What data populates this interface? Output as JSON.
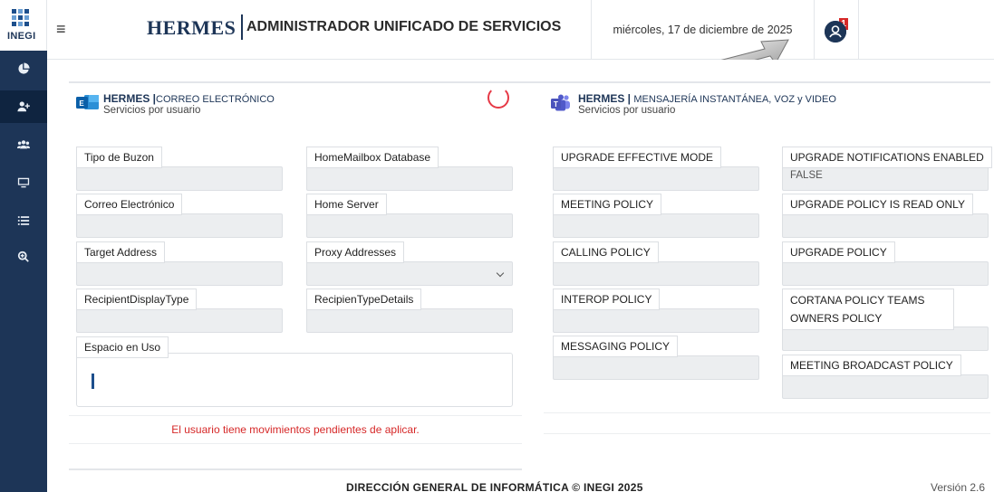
{
  "sidebar": {
    "logo_text": "INEGI",
    "items": [
      {
        "icon": "pie-chart-icon"
      },
      {
        "icon": "add-user-icon",
        "active": true
      },
      {
        "icon": "users-icon"
      },
      {
        "icon": "monitor-icon"
      },
      {
        "icon": "list-icon"
      },
      {
        "icon": "zoom-search-icon"
      }
    ]
  },
  "header": {
    "menu_icon": "hamburger-menu-icon",
    "brand": "HERMES",
    "subtitle": "ADMINISTRADOR UNIFICADO DE SERVICIOS",
    "date": "miércoles, 17 de diciembre de 2025",
    "notification_count": "1"
  },
  "left_panel": {
    "title_brand": "HERMES |",
    "title_rest": "CORREO ELECTRÓNICO",
    "subtitle": "Servicios por usuario",
    "fields": [
      {
        "label": "Tipo de Buzon",
        "value": ""
      },
      {
        "label": "HomeMailbox Database",
        "value": ""
      },
      {
        "label": "Correo Electrónico",
        "value": ""
      },
      {
        "label": "Home Server",
        "value": ""
      },
      {
        "label": "Target Address",
        "value": ""
      },
      {
        "label": "Proxy Addresses",
        "value": ""
      },
      {
        "label": "RecipientDisplayType",
        "value": ""
      },
      {
        "label": "RecipienTypeDetails",
        "value": ""
      }
    ],
    "usage_label": "Espacio en Uso",
    "usage_fraction": 0.0,
    "pending_message": "El usuario tiene movimientos pendientes de aplicar."
  },
  "right_panel": {
    "title_brand": "HERMES |",
    "title_rest": "MENSAJERÍA INSTANTÁNEA, VOZ y VIDEO",
    "subtitle": "Servicios por usuario",
    "fields": [
      {
        "label": "UPGRADE EFFECTIVE MODE",
        "value": ""
      },
      {
        "label": "UPGRADE NOTIFICATIONS ENABLED",
        "value": "FALSE"
      },
      {
        "label": "MEETING POLICY",
        "value": ""
      },
      {
        "label": "UPGRADE POLICY IS READ ONLY",
        "value": ""
      },
      {
        "label": "CALLING POLICY",
        "value": ""
      },
      {
        "label": "UPGRADE POLICY",
        "value": ""
      },
      {
        "label": "INTEROP POLICY",
        "value": ""
      },
      {
        "label": "CORTANA POLICY TEAMS OWNERS POLICY",
        "value": ""
      },
      {
        "label": "MESSAGING POLICY",
        "value": ""
      },
      {
        "label": "MEETING BROADCAST POLICY",
        "value": ""
      }
    ]
  },
  "footer": {
    "text": "DIRECCIÓN GENERAL DE INFORMÁTICA © INEGI 2025",
    "version": "Versión 2.6"
  },
  "colors": {
    "sidebar": "#1d3557",
    "brand": "#1d3557",
    "alert": "#d62828",
    "input_bg": "#eceef0"
  }
}
